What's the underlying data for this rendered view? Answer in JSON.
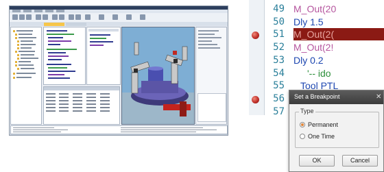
{
  "editor": {
    "lines": [
      {
        "number": "49",
        "code": "M_Out(20",
        "style": "fn",
        "breakpoint": false
      },
      {
        "number": "50",
        "code": "Dly 1.5",
        "style": "kw",
        "breakpoint": false
      },
      {
        "number": "51",
        "code": "M_Out(2(",
        "style": "highlight",
        "breakpoint": true
      },
      {
        "number": "52",
        "code": "M_Out(2!",
        "style": "fn",
        "breakpoint": false
      },
      {
        "number": "53",
        "code": "Dly 0.2",
        "style": "kw",
        "breakpoint": false
      },
      {
        "number": "54",
        "code": "'-- ido",
        "style": "comment",
        "breakpoint": false
      },
      {
        "number": "55",
        "code": "Tool PTL",
        "style": "kw",
        "breakpoint": false
      },
      {
        "number": "56",
        "code": "",
        "style": "kw",
        "breakpoint": true
      },
      {
        "number": "57",
        "code": "",
        "style": "kw",
        "breakpoint": false
      }
    ],
    "colors": {
      "function": "#b5559e",
      "keyword": "#1c46b0",
      "comment": "#2d8f3b",
      "highlight_bg": "#8b1a14",
      "line_number": "#2a7f9a"
    }
  },
  "dialog": {
    "title": "Set a Breakpoint",
    "close_icon": "close-icon",
    "group_label": "Type",
    "options": [
      {
        "label": "Permanent",
        "selected": true
      },
      {
        "label": "One Time",
        "selected": false
      }
    ],
    "ok_label": "OK",
    "cancel_label": "Cancel"
  },
  "ide_window": {
    "panels": [
      "project-tree",
      "code-editor",
      "variables-grid",
      "3d-robot-viewport",
      "properties-panel",
      "output-panel"
    ],
    "accent": "#f6c54a"
  }
}
